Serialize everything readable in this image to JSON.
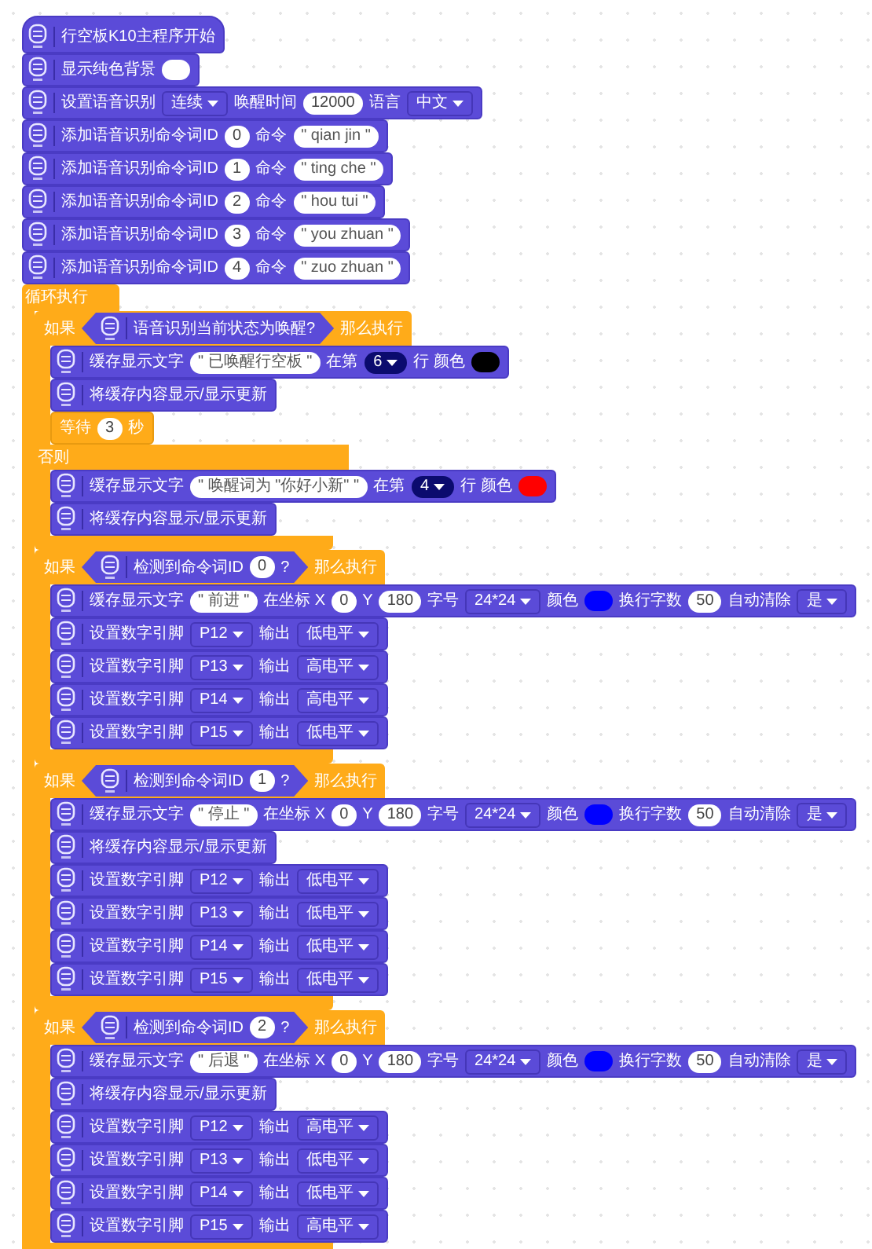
{
  "program": {
    "hat": {
      "parts": [
        {
          "kind": "label",
          "text": "行空板K10主程序开始"
        }
      ]
    },
    "blocks": [
      {
        "parts": [
          {
            "kind": "label",
            "text": "显示纯色背景"
          },
          {
            "kind": "color",
            "color": "#ffffff"
          }
        ]
      },
      {
        "parts": [
          {
            "kind": "label",
            "text": "设置语音识别"
          },
          {
            "kind": "dropdown",
            "text": "连续"
          },
          {
            "kind": "label",
            "text": "唤醒时间"
          },
          {
            "kind": "num",
            "text": "12000"
          },
          {
            "kind": "label",
            "text": "语言"
          },
          {
            "kind": "dropdown",
            "text": "中文"
          }
        ]
      },
      {
        "parts": [
          {
            "kind": "label",
            "text": "添加语音识别命令词ID"
          },
          {
            "kind": "num",
            "text": "0"
          },
          {
            "kind": "label",
            "text": "命令"
          },
          {
            "kind": "str",
            "text": "\" qian jin \""
          }
        ]
      },
      {
        "parts": [
          {
            "kind": "label",
            "text": "添加语音识别命令词ID"
          },
          {
            "kind": "num",
            "text": "1"
          },
          {
            "kind": "label",
            "text": "命令"
          },
          {
            "kind": "str",
            "text": "\" ting che \""
          }
        ]
      },
      {
        "parts": [
          {
            "kind": "label",
            "text": "添加语音识别命令词ID"
          },
          {
            "kind": "num",
            "text": "2"
          },
          {
            "kind": "label",
            "text": "命令"
          },
          {
            "kind": "str",
            "text": "\" hou tui \""
          }
        ]
      },
      {
        "parts": [
          {
            "kind": "label",
            "text": "添加语音识别命令词ID"
          },
          {
            "kind": "num",
            "text": "3"
          },
          {
            "kind": "label",
            "text": "命令"
          },
          {
            "kind": "str",
            "text": "\" you zhuan \""
          }
        ]
      },
      {
        "parts": [
          {
            "kind": "label",
            "text": "添加语音识别命令词ID"
          },
          {
            "kind": "num",
            "text": "4"
          },
          {
            "kind": "label",
            "text": "命令"
          },
          {
            "kind": "str",
            "text": "\" zuo zhuan \""
          }
        ]
      }
    ],
    "loop": {
      "label": "循环执行",
      "body": [
        {
          "kind": "if",
          "label": "如果",
          "condition": {
            "parts": [
              {
                "kind": "label",
                "text": "语音识别当前状态为唤醒?"
              }
            ]
          },
          "then_label": "那么执行",
          "body": [
            {
              "kind": "block",
              "parts": [
                {
                  "kind": "label",
                  "text": "缓存显示文字"
                },
                {
                  "kind": "str",
                  "text": "\" 已唤醒行空板 \""
                },
                {
                  "kind": "label",
                  "text": "在第"
                },
                {
                  "kind": "dark_dropdown",
                  "text": "6"
                },
                {
                  "kind": "label",
                  "text": "行 颜色"
                },
                {
                  "kind": "color",
                  "color": "#000000"
                }
              ]
            },
            {
              "kind": "block",
              "parts": [
                {
                  "kind": "label",
                  "text": "将缓存内容显示/显示更新"
                }
              ]
            },
            {
              "kind": "wait",
              "parts": [
                {
                  "kind": "label",
                  "text": "等待"
                },
                {
                  "kind": "num",
                  "text": "3"
                },
                {
                  "kind": "label",
                  "text": "秒"
                }
              ]
            }
          ],
          "else_label": "否则",
          "else_body": [
            {
              "kind": "block",
              "parts": [
                {
                  "kind": "label",
                  "text": "缓存显示文字"
                },
                {
                  "kind": "str",
                  "text": "\" 唤醒词为 \"你好小新\" \""
                },
                {
                  "kind": "label",
                  "text": "在第"
                },
                {
                  "kind": "dark_dropdown",
                  "text": "4"
                },
                {
                  "kind": "label",
                  "text": "行 颜色"
                },
                {
                  "kind": "color",
                  "color": "#ff0000"
                }
              ]
            },
            {
              "kind": "block",
              "parts": [
                {
                  "kind": "label",
                  "text": "将缓存内容显示/显示更新"
                }
              ]
            }
          ]
        },
        {
          "kind": "if",
          "label": "如果",
          "condition": {
            "parts": [
              {
                "kind": "label",
                "text": "检测到命令词ID"
              },
              {
                "kind": "num",
                "text": "0"
              },
              {
                "kind": "label",
                "text": "?"
              }
            ]
          },
          "then_label": "那么执行",
          "body": [
            {
              "kind": "block",
              "parts": [
                {
                  "kind": "label",
                  "text": "缓存显示文字"
                },
                {
                  "kind": "str",
                  "text": "\" 前进 \""
                },
                {
                  "kind": "label",
                  "text": "在坐标 X"
                },
                {
                  "kind": "num",
                  "text": "0"
                },
                {
                  "kind": "label",
                  "text": "Y"
                },
                {
                  "kind": "num",
                  "text": "180"
                },
                {
                  "kind": "label",
                  "text": "字号"
                },
                {
                  "kind": "dropdown",
                  "text": "24*24"
                },
                {
                  "kind": "label",
                  "text": "颜色"
                },
                {
                  "kind": "color",
                  "color": "#0000ff"
                },
                {
                  "kind": "label",
                  "text": "换行字数"
                },
                {
                  "kind": "num",
                  "text": "50"
                },
                {
                  "kind": "label",
                  "text": "自动清除"
                },
                {
                  "kind": "dropdown",
                  "text": "是"
                }
              ]
            },
            {
              "kind": "block",
              "parts": [
                {
                  "kind": "label",
                  "text": "设置数字引脚"
                },
                {
                  "kind": "dropdown",
                  "text": "P12"
                },
                {
                  "kind": "label",
                  "text": "输出"
                },
                {
                  "kind": "dropdown",
                  "text": "低电平"
                }
              ]
            },
            {
              "kind": "block",
              "parts": [
                {
                  "kind": "label",
                  "text": "设置数字引脚"
                },
                {
                  "kind": "dropdown",
                  "text": "P13"
                },
                {
                  "kind": "label",
                  "text": "输出"
                },
                {
                  "kind": "dropdown",
                  "text": "高电平"
                }
              ]
            },
            {
              "kind": "block",
              "parts": [
                {
                  "kind": "label",
                  "text": "设置数字引脚"
                },
                {
                  "kind": "dropdown",
                  "text": "P14"
                },
                {
                  "kind": "label",
                  "text": "输出"
                },
                {
                  "kind": "dropdown",
                  "text": "高电平"
                }
              ]
            },
            {
              "kind": "block",
              "parts": [
                {
                  "kind": "label",
                  "text": "设置数字引脚"
                },
                {
                  "kind": "dropdown",
                  "text": "P15"
                },
                {
                  "kind": "label",
                  "text": "输出"
                },
                {
                  "kind": "dropdown",
                  "text": "低电平"
                }
              ]
            }
          ]
        },
        {
          "kind": "if",
          "label": "如果",
          "condition": {
            "parts": [
              {
                "kind": "label",
                "text": "检测到命令词ID"
              },
              {
                "kind": "num",
                "text": "1"
              },
              {
                "kind": "label",
                "text": "?"
              }
            ]
          },
          "then_label": "那么执行",
          "body": [
            {
              "kind": "block",
              "parts": [
                {
                  "kind": "label",
                  "text": "缓存显示文字"
                },
                {
                  "kind": "str",
                  "text": "\" 停止 \""
                },
                {
                  "kind": "label",
                  "text": "在坐标 X"
                },
                {
                  "kind": "num",
                  "text": "0"
                },
                {
                  "kind": "label",
                  "text": "Y"
                },
                {
                  "kind": "num",
                  "text": "180"
                },
                {
                  "kind": "label",
                  "text": "字号"
                },
                {
                  "kind": "dropdown",
                  "text": "24*24"
                },
                {
                  "kind": "label",
                  "text": "颜色"
                },
                {
                  "kind": "color",
                  "color": "#0000ff"
                },
                {
                  "kind": "label",
                  "text": "换行字数"
                },
                {
                  "kind": "num",
                  "text": "50"
                },
                {
                  "kind": "label",
                  "text": "自动清除"
                },
                {
                  "kind": "dropdown",
                  "text": "是"
                }
              ]
            },
            {
              "kind": "block",
              "parts": [
                {
                  "kind": "label",
                  "text": "将缓存内容显示/显示更新"
                }
              ]
            },
            {
              "kind": "block",
              "parts": [
                {
                  "kind": "label",
                  "text": "设置数字引脚"
                },
                {
                  "kind": "dropdown",
                  "text": "P12"
                },
                {
                  "kind": "label",
                  "text": "输出"
                },
                {
                  "kind": "dropdown",
                  "text": "低电平"
                }
              ]
            },
            {
              "kind": "block",
              "parts": [
                {
                  "kind": "label",
                  "text": "设置数字引脚"
                },
                {
                  "kind": "dropdown",
                  "text": "P13"
                },
                {
                  "kind": "label",
                  "text": "输出"
                },
                {
                  "kind": "dropdown",
                  "text": "低电平"
                }
              ]
            },
            {
              "kind": "block",
              "parts": [
                {
                  "kind": "label",
                  "text": "设置数字引脚"
                },
                {
                  "kind": "dropdown",
                  "text": "P14"
                },
                {
                  "kind": "label",
                  "text": "输出"
                },
                {
                  "kind": "dropdown",
                  "text": "低电平"
                }
              ]
            },
            {
              "kind": "block",
              "parts": [
                {
                  "kind": "label",
                  "text": "设置数字引脚"
                },
                {
                  "kind": "dropdown",
                  "text": "P15"
                },
                {
                  "kind": "label",
                  "text": "输出"
                },
                {
                  "kind": "dropdown",
                  "text": "低电平"
                }
              ]
            }
          ]
        },
        {
          "kind": "if",
          "label": "如果",
          "condition": {
            "parts": [
              {
                "kind": "label",
                "text": "检测到命令词ID"
              },
              {
                "kind": "num",
                "text": "2"
              },
              {
                "kind": "label",
                "text": "?"
              }
            ]
          },
          "then_label": "那么执行",
          "body": [
            {
              "kind": "block",
              "parts": [
                {
                  "kind": "label",
                  "text": "缓存显示文字"
                },
                {
                  "kind": "str",
                  "text": "\" 后退 \""
                },
                {
                  "kind": "label",
                  "text": "在坐标 X"
                },
                {
                  "kind": "num",
                  "text": "0"
                },
                {
                  "kind": "label",
                  "text": "Y"
                },
                {
                  "kind": "num",
                  "text": "180"
                },
                {
                  "kind": "label",
                  "text": "字号"
                },
                {
                  "kind": "dropdown",
                  "text": "24*24"
                },
                {
                  "kind": "label",
                  "text": "颜色"
                },
                {
                  "kind": "color",
                  "color": "#0000ff"
                },
                {
                  "kind": "label",
                  "text": "换行字数"
                },
                {
                  "kind": "num",
                  "text": "50"
                },
                {
                  "kind": "label",
                  "text": "自动清除"
                },
                {
                  "kind": "dropdown",
                  "text": "是"
                }
              ]
            },
            {
              "kind": "block",
              "parts": [
                {
                  "kind": "label",
                  "text": "将缓存内容显示/显示更新"
                }
              ]
            },
            {
              "kind": "block",
              "parts": [
                {
                  "kind": "label",
                  "text": "设置数字引脚"
                },
                {
                  "kind": "dropdown",
                  "text": "P12"
                },
                {
                  "kind": "label",
                  "text": "输出"
                },
                {
                  "kind": "dropdown",
                  "text": "高电平"
                }
              ]
            },
            {
              "kind": "block",
              "parts": [
                {
                  "kind": "label",
                  "text": "设置数字引脚"
                },
                {
                  "kind": "dropdown",
                  "text": "P13"
                },
                {
                  "kind": "label",
                  "text": "输出"
                },
                {
                  "kind": "dropdown",
                  "text": "低电平"
                }
              ]
            },
            {
              "kind": "block",
              "parts": [
                {
                  "kind": "label",
                  "text": "设置数字引脚"
                },
                {
                  "kind": "dropdown",
                  "text": "P14"
                },
                {
                  "kind": "label",
                  "text": "输出"
                },
                {
                  "kind": "dropdown",
                  "text": "低电平"
                }
              ]
            },
            {
              "kind": "block",
              "parts": [
                {
                  "kind": "label",
                  "text": "设置数字引脚"
                },
                {
                  "kind": "dropdown",
                  "text": "P15"
                },
                {
                  "kind": "label",
                  "text": "输出"
                },
                {
                  "kind": "dropdown",
                  "text": "高电平"
                }
              ]
            }
          ]
        }
      ]
    }
  }
}
